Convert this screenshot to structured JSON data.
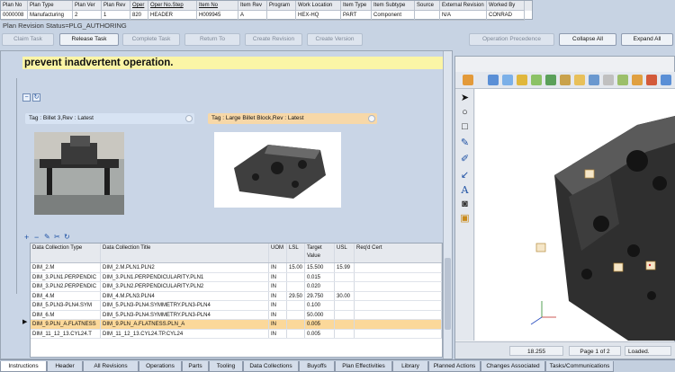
{
  "header_grid": {
    "columns": [
      "Plan No",
      "Plan Type",
      "Plan Ver",
      "Plan Rev",
      "Oper",
      "Oper No.Step",
      "Item No",
      "Item Rev",
      "Program",
      "Work Location",
      "Item Type",
      "Item Subtype",
      "Source",
      "External Revision",
      "Worked By"
    ],
    "values": [
      "0000008",
      "Manufacturing",
      "2",
      "1",
      "820",
      "HEADER",
      "H009945",
      "A",
      "",
      "HEX-HQ",
      "PART",
      "Component",
      "",
      "N/A",
      "CONRAD"
    ]
  },
  "status_text": "Plan Revision Status=PLG_AUTHORING",
  "toolbar": {
    "claim_task": "Claim Task",
    "release_task": "Release Task",
    "complete_task": "Complete Task",
    "return_to": "Return To",
    "create_revision": "Create Revision",
    "create_version": "Create Version",
    "operation_precedence": "Operation Precedence",
    "collapse_all": "Collapse All",
    "expand_all": "Expand All"
  },
  "instruction_text": "prevent inadvertent operation.",
  "tags": {
    "tag1": "Tag : Billet 3,Rev : Latest",
    "tag2": "Tag : Large Billet Block,Rev : Latest"
  },
  "table": {
    "headers": [
      "Data Collection Type",
      "Data Collection Title",
      "UOM",
      "LSL",
      "Target Value",
      "USL",
      "Req'd Cert"
    ],
    "rows": [
      [
        "DIM_2.M",
        "DIM_2.M.PLN1.PLN2",
        "IN",
        "15.00",
        "15.500",
        "15.99",
        ""
      ],
      [
        "DIM_3.PLN1.PERPENDIC",
        "DIM_3.PLN1.PERPENDICULARITY.PLN1",
        "IN",
        "",
        "0.015",
        "",
        ""
      ],
      [
        "DIM_3.PLN2.PERPENDIC",
        "DIM_3.PLN2.PERPENDICULARITY.PLN2",
        "IN",
        "",
        "0.020",
        "",
        ""
      ],
      [
        "DIM_4.M",
        "DIM_4.M.PLN3.PLN4",
        "IN",
        "29.50",
        "29.750",
        "30.00",
        ""
      ],
      [
        "DIM_5.PLN3-PLN4.SYM",
        "DIM_5.PLN3-PLN4.SYMMETRY.PLN3-PLN4",
        "IN",
        "",
        "0.100",
        "",
        ""
      ],
      [
        "DIM_6.M",
        "DIM_5.PLN3-PLN4.SYMMETRY.PLN3-PLN4",
        "IN",
        "",
        "50.000",
        "",
        ""
      ],
      [
        "DIM_9.PLN_A.FLATNESS",
        "DIM_9.PLN_A.FLATNESS.PLN_A",
        "IN",
        "",
        "0.005",
        "",
        ""
      ],
      [
        "DIM_11_12_13.CYL24.T",
        "DIM_11_12_13.CYL24.TP.CYL24",
        "IN",
        "",
        "0.005",
        "",
        ""
      ]
    ],
    "selected_index": 6
  },
  "viewer_status": {
    "coord": "18.255",
    "page": "Page 1 of 2",
    "state": "Loaded."
  },
  "tabs": [
    "Instructions",
    "Header",
    "All Revisions",
    "Operations",
    "Parts",
    "Tooling",
    "Data Collections",
    "Buyoffs",
    "Plan Effectivities",
    "Library",
    "Planned Actions",
    "Changes Associated",
    "Tasks/Communications"
  ],
  "colors": {
    "background": "#c7d3e3",
    "selection": "#fbd89a",
    "highlight": "#fbf5a6",
    "tag_blue": "#d7e3f3",
    "tag_orange": "#f7d8a8"
  }
}
